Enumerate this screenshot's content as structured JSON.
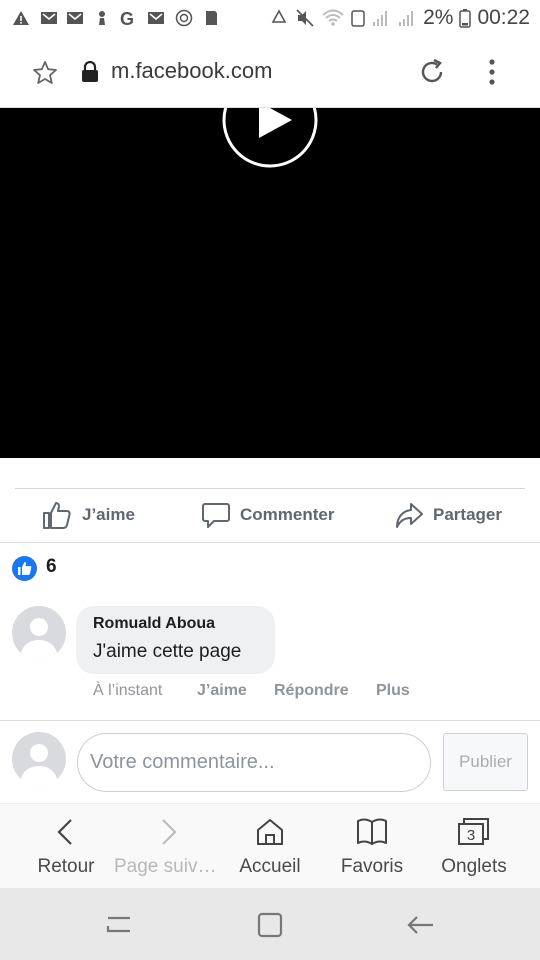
{
  "status_bar": {
    "battery": "2%",
    "time": "00:22",
    "left_icons": [
      "warning-icon",
      "gmail-icon",
      "gmail-icon",
      "chess-pawn-icon",
      "google-icon",
      "gmail-icon",
      "target-icon",
      "sd-card-icon"
    ],
    "right_icons": [
      "recycle-icon",
      "mute-icon",
      "wifi-icon",
      "signal-icon",
      "signal-icon",
      "battery-icon"
    ]
  },
  "browser": {
    "url": "m.facebook.com",
    "icons": [
      "star-icon",
      "lock-icon",
      "reload-icon",
      "more-vert-icon"
    ]
  },
  "video": {
    "play_icon": "play-icon"
  },
  "actions": {
    "like_label": "J’aime",
    "comment_label": "Commenter",
    "share_label": "Partager"
  },
  "reactions": {
    "count": "6",
    "icon": "like-reaction-icon"
  },
  "comment": {
    "author": "Romuald Aboua",
    "text": "J'aime cette page",
    "time": "À l’instant",
    "like": "J’aime",
    "reply": "Répondre",
    "more": "Plus"
  },
  "composer": {
    "placeholder": "Votre commentaire...",
    "publish_label": "Publier"
  },
  "browser_nav": {
    "back": "Retour",
    "forward": "Page suiva…",
    "home": "Accueil",
    "bookmarks": "Favoris",
    "tabs": "Onglets",
    "tab_count": "3"
  },
  "colors": {
    "facebook_blue": "#1877f2",
    "action_gray": "#606770",
    "meta_gray": "#90949c"
  }
}
